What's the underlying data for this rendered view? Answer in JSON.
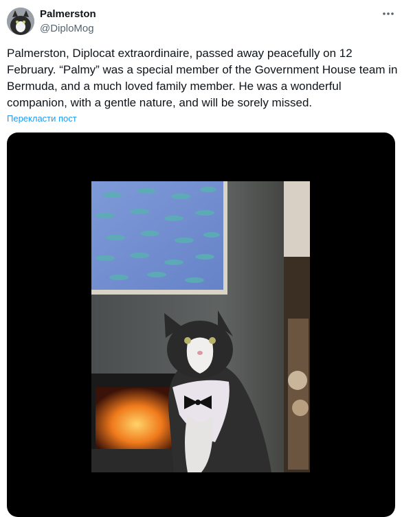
{
  "author": {
    "display_name": "Palmerston",
    "handle": "@DiploMog",
    "avatar_icon": "cat-avatar"
  },
  "tweet": {
    "text": "Palmerston, Diplocat extraordinaire, passed away peacefully on 12 February. “Palmy” was a special member of the Government House team in Bermuda, and a much loved family member. He was a wonderful companion, with a gentle nature, and will be sorely missed.",
    "translate_label": "Перекласти пост"
  },
  "icons": {
    "more": "more-icon"
  },
  "colors": {
    "link": "#1d9bf0",
    "text": "#0f1419",
    "secondary": "#536471",
    "media_bg": "#000000"
  }
}
